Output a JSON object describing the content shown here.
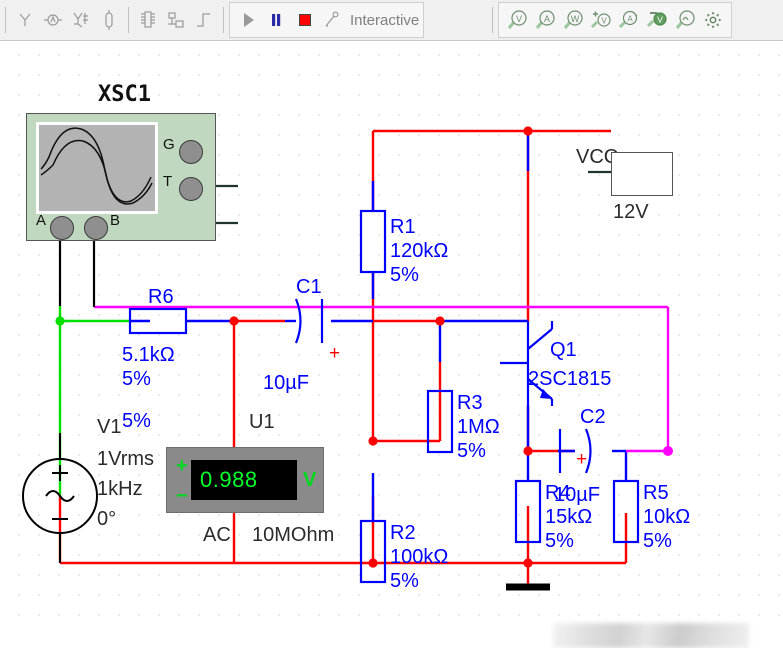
{
  "toolbar": {
    "icons_left": [
      {
        "name": "probe-icon",
        "glyph": "Y"
      },
      {
        "name": "measurement-probe-icon",
        "glyph": "M"
      },
      {
        "name": "network-analyzer-icon",
        "glyph": "net"
      },
      {
        "name": "component-icon",
        "glyph": "cap"
      }
    ],
    "icons_mid": [
      {
        "name": "ic-component-icon",
        "glyph": "chip"
      },
      {
        "name": "hierarchy-block-icon",
        "glyph": "block"
      },
      {
        "name": "step-function-icon",
        "glyph": "step"
      }
    ],
    "run_label": "",
    "pause_label": "",
    "stop_label": "",
    "mode_label": "Interactive",
    "icons_right": [
      {
        "name": "voltage-probe-icon",
        "glyph": "V"
      },
      {
        "name": "current-probe-icon",
        "glyph": "A"
      },
      {
        "name": "power-probe-icon",
        "glyph": "W"
      },
      {
        "name": "differential-voltage-probe-icon",
        "glyph": "+V"
      },
      {
        "name": "differential-current-probe-icon",
        "glyph": "A"
      },
      {
        "name": "reference-voltage-probe-icon",
        "glyph": "V"
      },
      {
        "name": "waveform-probe-icon",
        "glyph": "J"
      },
      {
        "name": "probe-settings-icon",
        "glyph": "gear"
      }
    ]
  },
  "instruments": {
    "oscilloscope": {
      "ref": "XSC1",
      "terminals": [
        {
          "name": "channel-a",
          "label": "A"
        },
        {
          "name": "channel-b",
          "label": "B"
        },
        {
          "name": "ground",
          "label": "G"
        },
        {
          "name": "trigger",
          "label": "T"
        }
      ]
    },
    "multimeter": {
      "ref": "U1",
      "value": "0.988",
      "unit": "V",
      "plus": "+",
      "minus": "−",
      "mode": "AC",
      "impedance": "10MOhm"
    }
  },
  "sources": {
    "v1": {
      "ref": "V1",
      "tolerance": "5%",
      "amplitude": "1Vrms",
      "frequency": "1kHz",
      "phase": "0°"
    },
    "vcc": {
      "ref": "VCC",
      "value": "12V"
    }
  },
  "components": [
    {
      "ref": "R1",
      "value": "120kΩ",
      "tol": "5%",
      "type": "resistor"
    },
    {
      "ref": "R2",
      "value": "100kΩ",
      "tol": "5%",
      "type": "resistor"
    },
    {
      "ref": "R3",
      "value": "1MΩ",
      "tol": "5%",
      "type": "resistor"
    },
    {
      "ref": "R4",
      "value": "15kΩ",
      "tol": "5%",
      "type": "resistor"
    },
    {
      "ref": "R5",
      "value": "10kΩ",
      "tol": "5%",
      "type": "resistor"
    },
    {
      "ref": "R6",
      "value": "5.1kΩ",
      "tol": "5%",
      "type": "resistor"
    },
    {
      "ref": "C1",
      "value": "10µF",
      "tol": "+",
      "type": "capacitor"
    },
    {
      "ref": "C2",
      "value": "10µF",
      "tol": "+",
      "type": "capacitor"
    },
    {
      "ref": "Q1",
      "value": "2SC1815",
      "tol": "",
      "type": "transistor"
    }
  ],
  "labels": {
    "r1_ref": "R1",
    "r1_val": "120kΩ",
    "r1_tol": "5%",
    "r2_ref": "R2",
    "r2_val": "100kΩ",
    "r2_tol": "5%",
    "r3_ref": "R3",
    "r3_val": "1MΩ",
    "r3_tol": "5%",
    "r4_ref": "R4",
    "r4_val": "15kΩ",
    "r4_tol": "5%",
    "r5_ref": "R5",
    "r5_val": "10kΩ",
    "r5_tol": "5%",
    "r6_ref": "R6",
    "r6_val": "5.1kΩ",
    "r6_tol": "5%",
    "c1_ref": "C1",
    "c1_val": "10µF",
    "c1_pol": "+",
    "c2_ref": "C2",
    "c2_val": "10µF",
    "c2_pol": "+",
    "q1_ref": "Q1",
    "q1_val": "2SC1815",
    "v1_ref": "V1",
    "v1_tol": "5%",
    "v1_amp": "1Vrms",
    "v1_freq": "1kHz",
    "v1_phase": "0°",
    "vcc_ref": "VCC",
    "vcc_val": "12V",
    "u1_ref": "U1",
    "u1_mode": "AC",
    "u1_imp": "10MOhm",
    "xsc1_ref": "XSC1",
    "probe_a": "A",
    "probe_b": "B",
    "probe_g": "G",
    "probe_t": "T"
  },
  "colors": {
    "wire_power": "#ff0000",
    "wire_signal": "#0000ff",
    "wire_input": "#00e000",
    "wire_output": "#ff00ff",
    "component_outline": "#0000ff",
    "label_text": "#0000ff",
    "scope_body": "#bfd8bf",
    "meter_body": "#8a8a8a",
    "lcd_text": "#00ff2a"
  }
}
